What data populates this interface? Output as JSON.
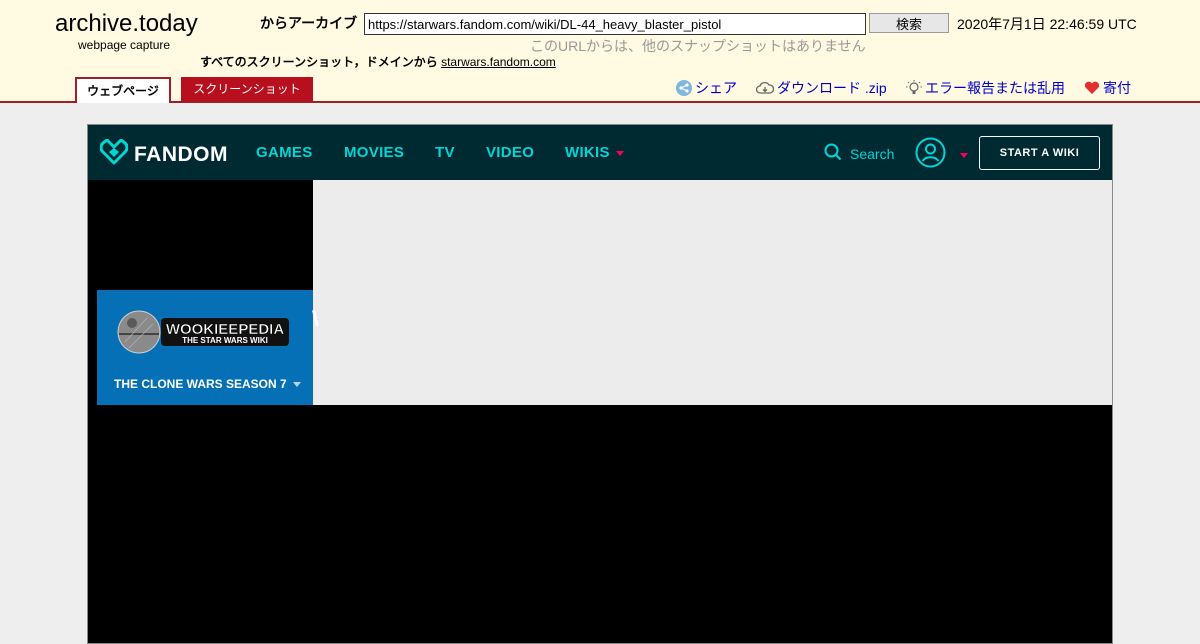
{
  "archive": {
    "brand_title": "archive.today",
    "brand_sub": "webpage capture",
    "archive_label": "からアーカイブ",
    "url_value": "https://starwars.fandom.com/wiki/DL-44_heavy_blaster_pistol",
    "search_label": "検索",
    "timestamp": "2020年7月1日 22:46:59 UTC",
    "no_snapshots": "このURLからは、他のスナップショットはありません",
    "all_shots_prefix": "すべてのスクリーンショット，ドメインから",
    "domain_link": "starwars.fandom.com",
    "tabs": [
      {
        "label": "ウェブページ",
        "active": true
      },
      {
        "label": "スクリーンショット",
        "active": false
      }
    ],
    "links": {
      "share": "シェア",
      "download": "ダウンロード .zip",
      "report": "エラー報告または乱用",
      "donate": "寄付"
    }
  },
  "fandom": {
    "logo_text": "FANDOM",
    "nav": [
      "GAMES",
      "MOVIES",
      "TV",
      "VIDEO",
      "WIKIS"
    ],
    "search_label": "Search",
    "start_wiki": "START A WIKI",
    "wiki_logo_main": "WOOKIEEPEDIA",
    "wiki_logo_sub": "THE STAR WARS WIKI",
    "wiki_dropdown": "THE CLONE WARS SEASON 7",
    "colors": {
      "bar": "#002a32",
      "accent": "#00d6d6",
      "wiki_blue": "#0570b6",
      "caret": "#fa005a"
    }
  }
}
